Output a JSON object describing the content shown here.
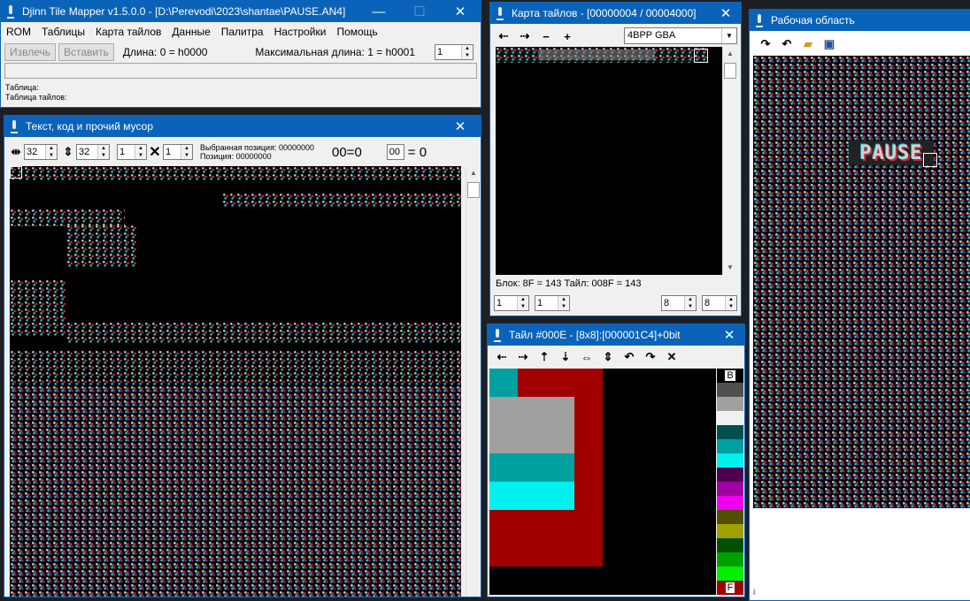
{
  "main": {
    "title": "Djinn Tile Mapper v1.5.0.0 - [D:\\Perevodi\\2023\\shantae\\PAUSE.AN4]",
    "menu": [
      "ROM",
      "Таблицы",
      "Карта тайлов",
      "Данные",
      "Палитра",
      "Настройки",
      "Помощь"
    ],
    "extract_label": "Извлечь",
    "insert_label": "Вставить",
    "length_label": "Длина: 0 = h0000",
    "maxlen_label": "Максимальная длина: 1 = h0001",
    "maxlen_value": "1",
    "table_label": "Таблица:",
    "tile_table_label": "Таблица тайлов:"
  },
  "text_win": {
    "title": "Текст, код и прочий мусор",
    "width_value": "32",
    "height_value": "32",
    "w2_value": "1",
    "h2_value": "1",
    "selected_pos": "Выбранная позиция: 00000000",
    "position": "Позиция: 00000000",
    "eq_display": "00=0",
    "hex_input": "00",
    "eq_result": "= 0"
  },
  "tilemap_win": {
    "title": "Карта тайлов - [00000004 / 00004000]",
    "format_value": "4BPP GBA",
    "block_info": "Блок: 8F = 143  Тайл: 008F = 143",
    "s1": "1",
    "s2": "1",
    "s3": "8",
    "s4": "8",
    "tools": [
      "⇠",
      "⇢",
      "−",
      "+"
    ]
  },
  "tile_win": {
    "title": "Тайл #000E - [8x8]:[000001C4]+0bit",
    "pal_top_label": "B",
    "pal_bottom_label": "F",
    "palette": [
      "#000000",
      "#505050",
      "#a0a0a0",
      "#f0f0f0",
      "#005050",
      "#00a0a0",
      "#00f0f0",
      "#500050",
      "#a000a0",
      "#f000f0",
      "#505000",
      "#a0a000",
      "#005000",
      "#00a000",
      "#00f000",
      "#a00000"
    ]
  },
  "work_win": {
    "title": "Рабочая область",
    "label": "PAUSE",
    "footer_text": "i"
  }
}
